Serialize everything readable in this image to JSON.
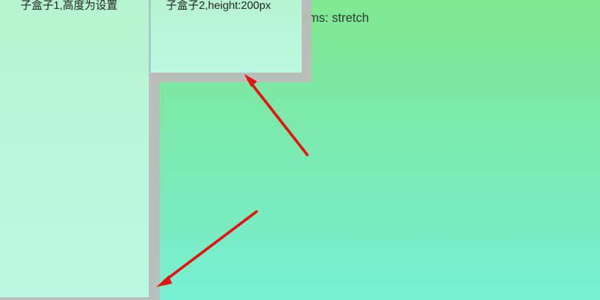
{
  "background_caption": "ems: stretch",
  "box1": {
    "label": "子盒子1,高度为设置"
  },
  "box2": {
    "label": "子盒子2,height:200px"
  },
  "colors": {
    "arrow": "#e8120e",
    "box_shadow": "#bdbdbd",
    "background_top": "#7fe890",
    "background_bottom": "#78f0d4"
  },
  "icons": [
    "arrow-icon",
    "arrow-icon"
  ]
}
